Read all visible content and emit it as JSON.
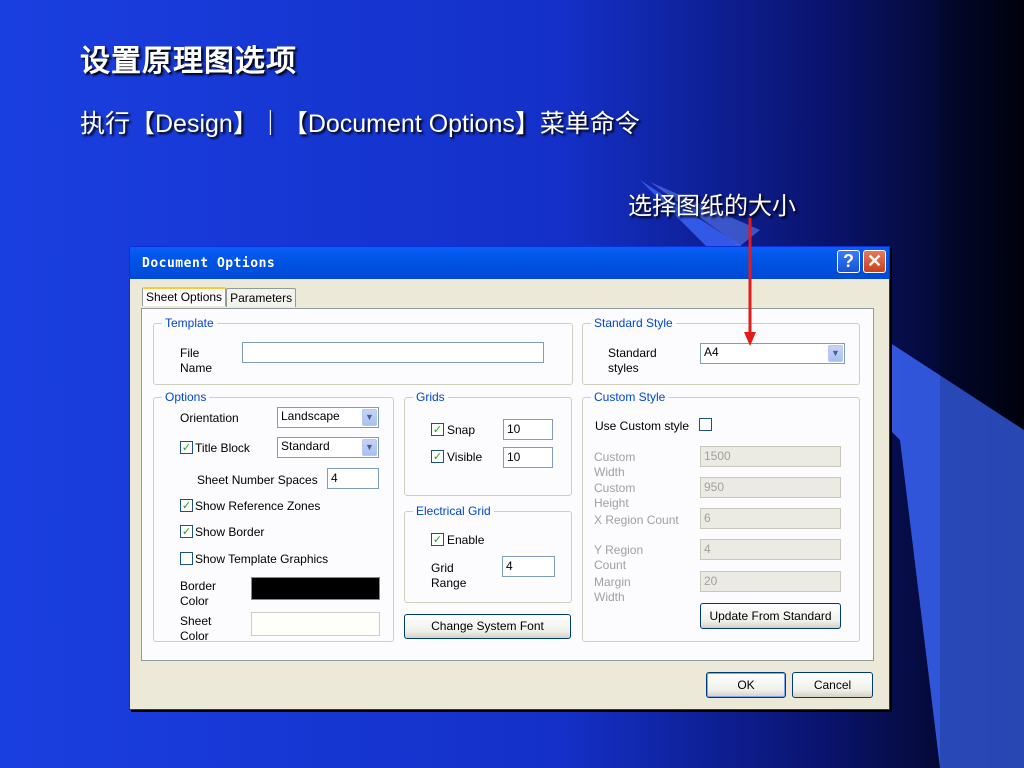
{
  "slide": {
    "title": "设置原理图选项",
    "subtitle": "执行【Design】｜【Document Options】菜单命令",
    "annotation": "选择图纸的大小",
    "arrow_color": "#e21b1b"
  },
  "dialog": {
    "title": "Document Options",
    "help_label": "?",
    "close_label": "✕",
    "tabs": [
      {
        "label": "Sheet Options",
        "active": true
      },
      {
        "label": "Parameters",
        "active": false
      }
    ],
    "template": {
      "legend": "Template",
      "file_name_label": "File Name",
      "file_name_value": ""
    },
    "standard_style": {
      "legend": "Standard Style",
      "label": "Standard styles",
      "value": "A4"
    },
    "options": {
      "legend": "Options",
      "orientation_label": "Orientation",
      "orientation_value": "Landscape",
      "title_block_label": "Title Block",
      "title_block_checked": true,
      "title_block_value": "Standard",
      "sheet_number_spaces_label": "Sheet Number Spaces",
      "sheet_number_spaces_value": "4",
      "show_reference_zones_label": "Show Reference Zones",
      "show_reference_zones_checked": true,
      "show_border_label": "Show Border",
      "show_border_checked": true,
      "show_template_graphics_label": "Show Template Graphics",
      "show_template_graphics_checked": false,
      "border_color_label": "Border Color",
      "border_color": "#000000",
      "sheet_color_label": "Sheet Color",
      "sheet_color": "#fffffa"
    },
    "grids": {
      "legend": "Grids",
      "snap_label": "Snap",
      "snap_checked": true,
      "snap_value": "10",
      "visible_label": "Visible",
      "visible_checked": true,
      "visible_value": "10"
    },
    "electrical_grid": {
      "legend": "Electrical Grid",
      "enable_label": "Enable",
      "enable_checked": true,
      "grid_range_label": "Grid Range",
      "grid_range_value": "4"
    },
    "change_font_button": "Change System Font",
    "custom_style": {
      "legend": "Custom Style",
      "use_custom_label": "Use Custom style",
      "use_custom_checked": false,
      "custom_width_label": "Custom Width",
      "custom_width_value": "1500",
      "custom_height_label": "Custom Height",
      "custom_height_value": "950",
      "x_region_count_label": "X Region Count",
      "x_region_count_value": "6",
      "y_region_count_label": "Y Region Count",
      "y_region_count_value": "4",
      "margin_width_label": "Margin Width",
      "margin_width_value": "20",
      "update_button": "Update From Standard"
    },
    "ok_button": "OK",
    "cancel_button": "Cancel"
  }
}
